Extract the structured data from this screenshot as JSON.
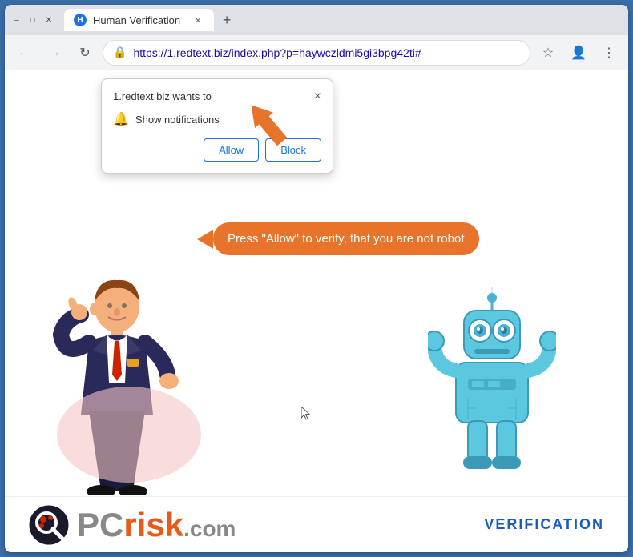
{
  "browser": {
    "title": "Human Verification",
    "url": "https://1.redtext.biz/index.php?p=haywczldmi5gi3bpg42ti#",
    "tab_label": "Human Verification",
    "new_tab_icon": "+",
    "back_icon": "←",
    "forward_icon": "→",
    "refresh_icon": "↻",
    "close_icon": "×"
  },
  "popup": {
    "title": "1.redtext.biz wants to",
    "notification_text": "Show notifications",
    "allow_label": "Allow",
    "block_label": "Block",
    "close_icon": "×"
  },
  "page": {
    "speech_bubble_text": "Press \"Allow\" to verify, that you are not robot",
    "footer": {
      "logo_pc": "PC",
      "logo_risk": "risk",
      "logo_com": ".com",
      "verification_label": "VERIFICATION"
    }
  },
  "colors": {
    "orange": "#e8732a",
    "blue": "#1a5cb8",
    "nav_bg": "#dee1e6",
    "url_bar_bg": "#f1f3f4"
  }
}
